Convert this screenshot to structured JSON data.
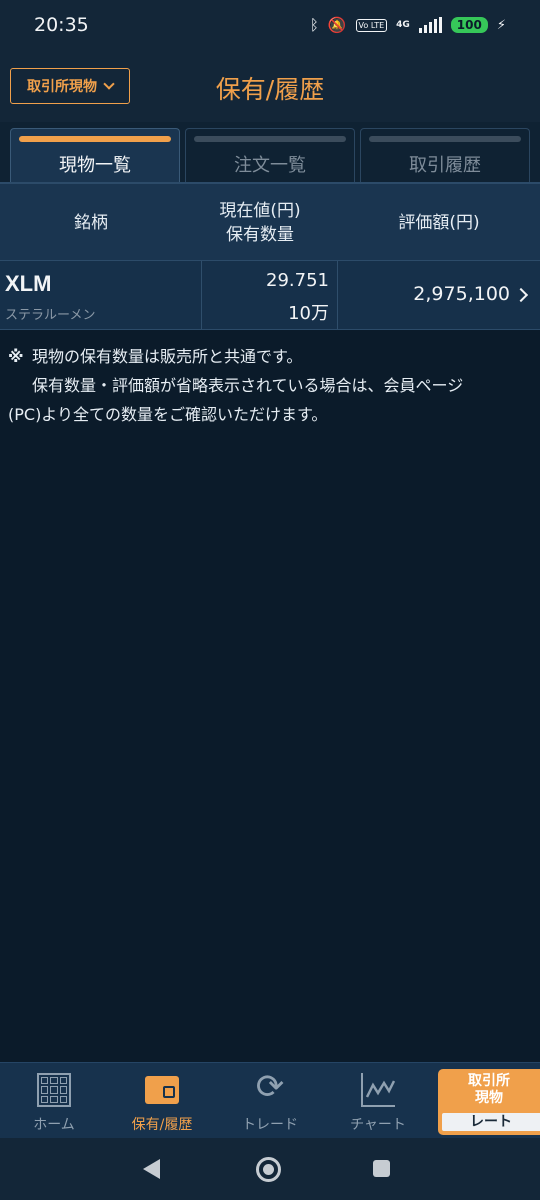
{
  "status": {
    "time": "20:35",
    "battery": "100",
    "network": "4G",
    "volte": "Vo LTE"
  },
  "header": {
    "exchange_label": "取引所現物",
    "title": "保有/履歴"
  },
  "tabs": [
    {
      "label": "現物一覧",
      "active": true
    },
    {
      "label": "注文一覧",
      "active": false
    },
    {
      "label": "取引履歴",
      "active": false
    }
  ],
  "table": {
    "col_symbol": "銘柄",
    "col_price": "現在値(円)",
    "col_qty": "保有数量",
    "col_value": "評価額(円)",
    "rows": [
      {
        "symbol": "XLM",
        "name": "ステラルーメン",
        "price": "29.751",
        "qty": "10万",
        "value": "2,975,100"
      }
    ]
  },
  "note": {
    "mark": "※",
    "line1": "現物の保有数量は販売所と共通です。",
    "line2": "保有数量・評価額が省略表示されている場合は、会員ページ",
    "line3": "(PC)より全ての数量をご確認いただけます。"
  },
  "nav": {
    "home": "ホーム",
    "holdings": "保有/履歴",
    "trade": "トレード",
    "chart": "チャート",
    "rate_top1": "取引所",
    "rate_top2": "現物",
    "rate_bottom": "レート"
  },
  "colors": {
    "accent": "#f0a04b",
    "background": "#0b1b2a",
    "panel": "#132638"
  }
}
